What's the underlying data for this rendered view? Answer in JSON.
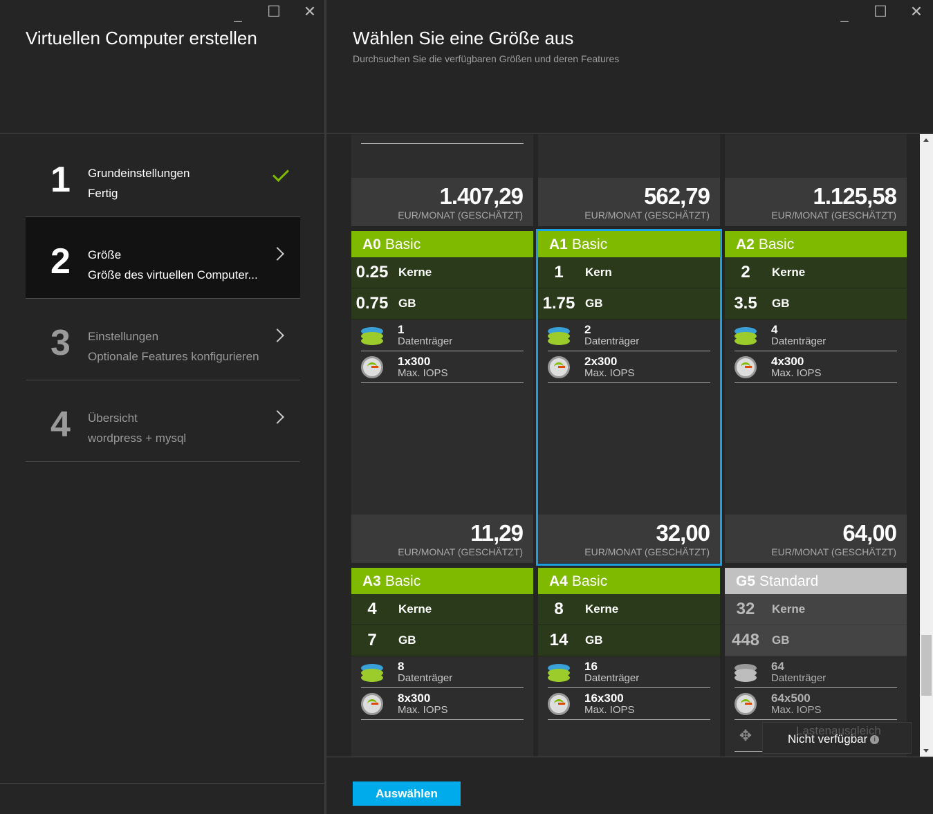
{
  "left": {
    "title": "Virtuellen Computer erstellen",
    "steps": [
      {
        "num": "1",
        "title": "Grundeinstellungen",
        "sub": "Fertig",
        "state": "done"
      },
      {
        "num": "2",
        "title": "Größe",
        "sub": "Größe des virtuellen Computer...",
        "state": "active"
      },
      {
        "num": "3",
        "title": "Einstellungen",
        "sub": "Optionale Features konfigurieren",
        "state": "pending"
      },
      {
        "num": "4",
        "title": "Übersicht",
        "sub": "wordpress + mysql",
        "state": "pending"
      }
    ]
  },
  "window_controls": {
    "minimize": "_",
    "maximize": "☐",
    "close": "✕"
  },
  "right": {
    "title": "Wählen Sie eine Größe aus",
    "subtitle": "Durchsuchen Sie die verfügbaren Größen und deren Features",
    "select_button": "Auswählen",
    "price_unit": "EUR/MONAT (GESCHÄTZT)",
    "prev_row_prices": [
      "1.407,29",
      "562,79",
      "1.125,58"
    ],
    "cards": [
      {
        "id": "A0",
        "tier": "Basic",
        "cores": "0.25",
        "cores_label": "Kerne",
        "ram": "0.75",
        "ram_label": "GB",
        "disks": "1",
        "disks_label": "Datenträger",
        "iops": "1x300",
        "iops_label": "Max. IOPS",
        "price": "11,29"
      },
      {
        "id": "A1",
        "tier": "Basic",
        "cores": "1",
        "cores_label": "Kern",
        "ram": "1.75",
        "ram_label": "GB",
        "disks": "2",
        "disks_label": "Datenträger",
        "iops": "2x300",
        "iops_label": "Max. IOPS",
        "price": "32,00",
        "selected": true
      },
      {
        "id": "A2",
        "tier": "Basic",
        "cores": "2",
        "cores_label": "Kerne",
        "ram": "3.5",
        "ram_label": "GB",
        "disks": "4",
        "disks_label": "Datenträger",
        "iops": "4x300",
        "iops_label": "Max. IOPS",
        "price": "64,00"
      },
      {
        "id": "A3",
        "tier": "Basic",
        "cores": "4",
        "cores_label": "Kerne",
        "ram": "7",
        "ram_label": "GB",
        "disks": "8",
        "disks_label": "Datenträger",
        "iops": "8x300",
        "iops_label": "Max. IOPS"
      },
      {
        "id": "A4",
        "tier": "Basic",
        "cores": "8",
        "cores_label": "Kerne",
        "ram": "14",
        "ram_label": "GB",
        "disks": "16",
        "disks_label": "Datenträger",
        "iops": "16x300",
        "iops_label": "Max. IOPS"
      },
      {
        "id": "G5",
        "tier": "Standard",
        "cores": "32",
        "cores_label": "Kerne",
        "ram": "448",
        "ram_label": "GB",
        "disks": "64",
        "disks_label": "Datenträger",
        "iops": "64x500",
        "iops_label": "Max. IOPS",
        "unavailable": true
      }
    ],
    "tooltip": {
      "faint": "Lastenausgleich",
      "text": "Nicht verfügbar",
      "info": "i"
    }
  },
  "colors": {
    "accent_green": "#7fba00",
    "selected_blue": "#1ba1e2",
    "button_blue": "#00abec"
  }
}
